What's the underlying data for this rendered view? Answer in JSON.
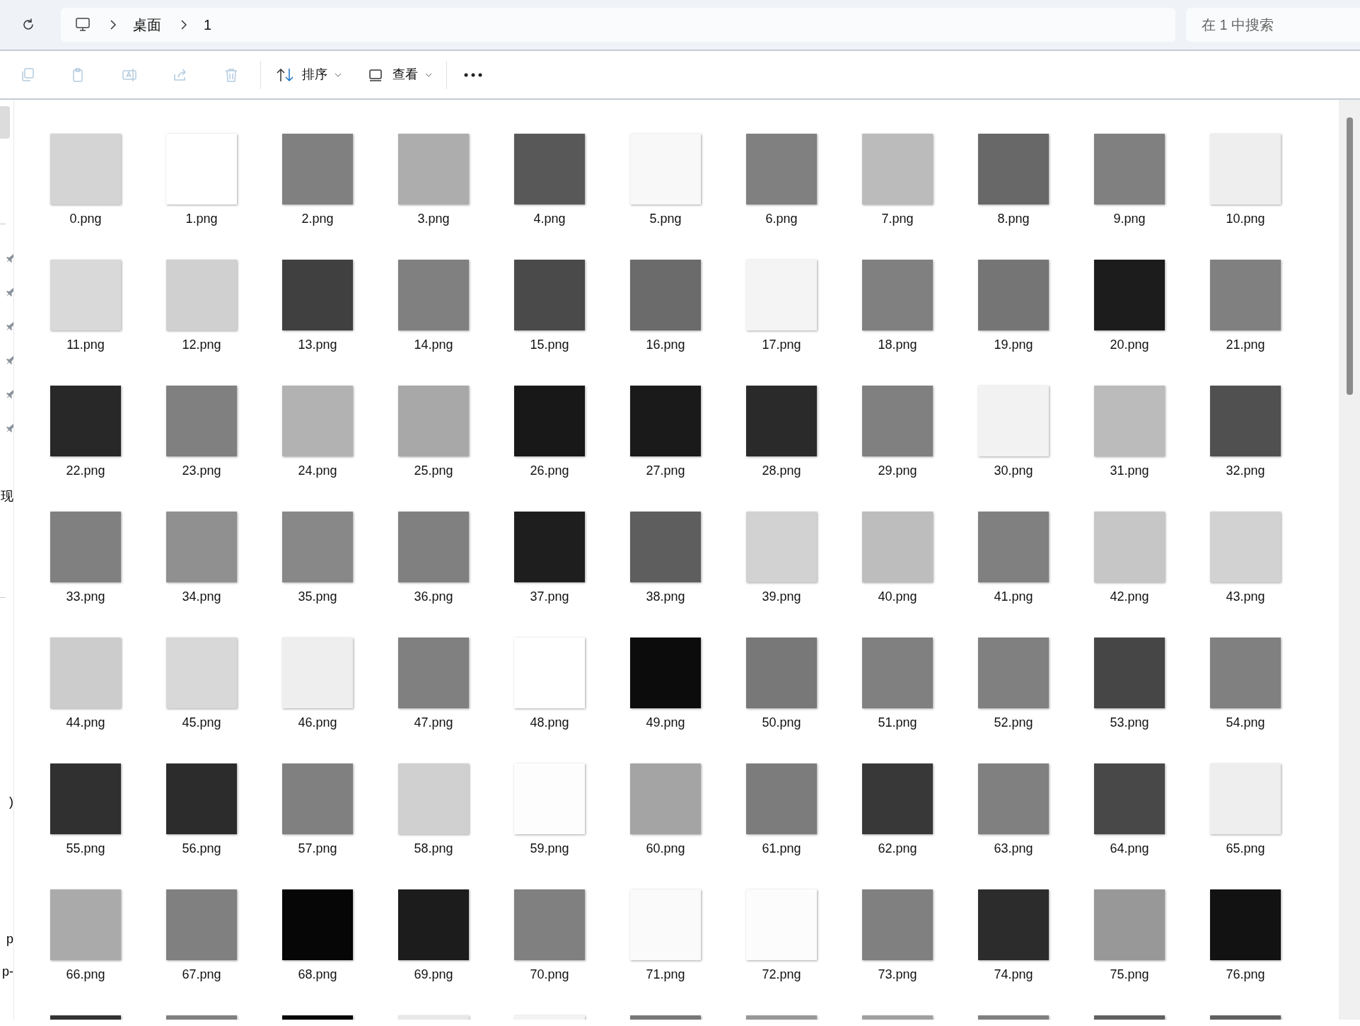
{
  "address_bar": {
    "segments": [
      "桌面",
      "1"
    ]
  },
  "search": {
    "placeholder": "在 1 中搜索"
  },
  "toolbar": {
    "actions": [
      {
        "kind": "copy",
        "disabled": true
      },
      {
        "kind": "paste",
        "disabled": true
      },
      {
        "kind": "rename",
        "disabled": true
      },
      {
        "kind": "share",
        "disabled": true
      },
      {
        "kind": "delete",
        "disabled": true
      }
    ],
    "sort": "排序",
    "view": "查看"
  },
  "sidebar": {
    "texts": [
      "现",
      ")",
      "p",
      "p-"
    ]
  },
  "files": [
    {
      "label": "0.png",
      "color": "#d4d4d4"
    },
    {
      "label": "1.png",
      "color": "#ffffff"
    },
    {
      "label": "2.png",
      "color": "#808080"
    },
    {
      "label": "3.png",
      "color": "#adadad"
    },
    {
      "label": "4.png",
      "color": "#585858"
    },
    {
      "label": "5.png",
      "color": "#f8f8f8"
    },
    {
      "label": "6.png",
      "color": "#808080"
    },
    {
      "label": "7.png",
      "color": "#bbbbbb"
    },
    {
      "label": "8.png",
      "color": "#686868"
    },
    {
      "label": "9.png",
      "color": "#808080"
    },
    {
      "label": "10.png",
      "color": "#eeeeee"
    },
    {
      "label": "11.png",
      "color": "#d9d9d9"
    },
    {
      "label": "12.png",
      "color": "#d0d0d0"
    },
    {
      "label": "13.png",
      "color": "#404040"
    },
    {
      "label": "14.png",
      "color": "#808080"
    },
    {
      "label": "15.png",
      "color": "#4a4a4a"
    },
    {
      "label": "16.png",
      "color": "#6b6b6b"
    },
    {
      "label": "17.png",
      "color": "#f4f4f4"
    },
    {
      "label": "18.png",
      "color": "#808080"
    },
    {
      "label": "19.png",
      "color": "#757575"
    },
    {
      "label": "20.png",
      "color": "#1c1c1c"
    },
    {
      "label": "21.png",
      "color": "#808080"
    },
    {
      "label": "22.png",
      "color": "#282828"
    },
    {
      "label": "23.png",
      "color": "#808080"
    },
    {
      "label": "24.png",
      "color": "#b2b2b2"
    },
    {
      "label": "25.png",
      "color": "#a8a8a8"
    },
    {
      "label": "26.png",
      "color": "#181818"
    },
    {
      "label": "27.png",
      "color": "#1a1a1a"
    },
    {
      "label": "28.png",
      "color": "#2a2a2a"
    },
    {
      "label": "29.png",
      "color": "#808080"
    },
    {
      "label": "30.png",
      "color": "#f2f2f2"
    },
    {
      "label": "31.png",
      "color": "#bbbbbb"
    },
    {
      "label": "32.png",
      "color": "#505050"
    },
    {
      "label": "33.png",
      "color": "#808080"
    },
    {
      "label": "34.png",
      "color": "#909090"
    },
    {
      "label": "35.png",
      "color": "#888888"
    },
    {
      "label": "36.png",
      "color": "#808080"
    },
    {
      "label": "37.png",
      "color": "#1e1e1e"
    },
    {
      "label": "38.png",
      "color": "#5e5e5e"
    },
    {
      "label": "39.png",
      "color": "#d2d2d2"
    },
    {
      "label": "40.png",
      "color": "#bdbdbd"
    },
    {
      "label": "41.png",
      "color": "#808080"
    },
    {
      "label": "42.png",
      "color": "#c6c6c6"
    },
    {
      "label": "43.png",
      "color": "#d2d2d2"
    },
    {
      "label": "44.png",
      "color": "#cccccc"
    },
    {
      "label": "45.png",
      "color": "#d8d8d8"
    },
    {
      "label": "46.png",
      "color": "#eeeeee"
    },
    {
      "label": "47.png",
      "color": "#808080"
    },
    {
      "label": "48.png",
      "color": "#ffffff"
    },
    {
      "label": "49.png",
      "color": "#0c0c0c"
    },
    {
      "label": "50.png",
      "color": "#787878"
    },
    {
      "label": "51.png",
      "color": "#808080"
    },
    {
      "label": "52.png",
      "color": "#808080"
    },
    {
      "label": "53.png",
      "color": "#464646"
    },
    {
      "label": "54.png",
      "color": "#808080"
    },
    {
      "label": "55.png",
      "color": "#303030"
    },
    {
      "label": "56.png",
      "color": "#2c2c2c"
    },
    {
      "label": "57.png",
      "color": "#808080"
    },
    {
      "label": "58.png",
      "color": "#d0d0d0"
    },
    {
      "label": "59.png",
      "color": "#fdfdfd"
    },
    {
      "label": "60.png",
      "color": "#a4a4a4"
    },
    {
      "label": "61.png",
      "color": "#7c7c7c"
    },
    {
      "label": "62.png",
      "color": "#383838"
    },
    {
      "label": "63.png",
      "color": "#808080"
    },
    {
      "label": "64.png",
      "color": "#484848"
    },
    {
      "label": "65.png",
      "color": "#eeeeee"
    },
    {
      "label": "66.png",
      "color": "#aaaaaa"
    },
    {
      "label": "67.png",
      "color": "#808080"
    },
    {
      "label": "68.png",
      "color": "#060606"
    },
    {
      "label": "69.png",
      "color": "#1c1c1c"
    },
    {
      "label": "70.png",
      "color": "#808080"
    },
    {
      "label": "71.png",
      "color": "#fafafa"
    },
    {
      "label": "72.png",
      "color": "#fcfcfc"
    },
    {
      "label": "73.png",
      "color": "#808080"
    },
    {
      "label": "74.png",
      "color": "#2c2c2c"
    },
    {
      "label": "75.png",
      "color": "#989898"
    },
    {
      "label": "76.png",
      "color": "#121212"
    },
    {
      "color": "#333333"
    },
    {
      "color": "#808080"
    },
    {
      "color": "#050505"
    },
    {
      "color": "#e8e8e8"
    },
    {
      "color": "#f4f4f4"
    },
    {
      "color": "#787878"
    },
    {
      "color": "#989898"
    },
    {
      "color": "#a0a0a0"
    },
    {
      "color": "#808080"
    },
    {
      "color": "#606060"
    },
    {
      "color": "#606060"
    }
  ]
}
